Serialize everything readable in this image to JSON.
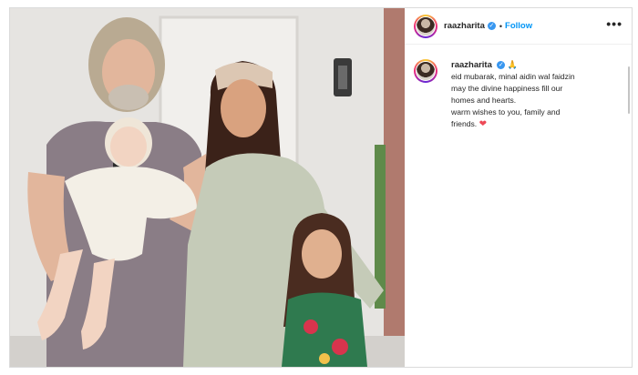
{
  "post": {
    "header": {
      "username": "raazharita",
      "follow_label": "Follow",
      "separator": "•",
      "more_label": "•••"
    },
    "caption": {
      "username": "raazharita",
      "emoji": "🙏",
      "lines": [
        "eid mubarak, minal aidin wal faidzin",
        "may the divine happiness fill our",
        "homes and hearts.",
        "warm wishes to you, family and",
        "friends."
      ],
      "heart": "❤"
    },
    "icons": {
      "verified": "verified-badge-icon",
      "more": "more-options-icon",
      "pray": "praying-hands-icon",
      "heart": "red-heart-icon"
    },
    "colors": {
      "follow": "#0095f6",
      "verified": "#3897f0",
      "heart": "#ed4956"
    }
  }
}
